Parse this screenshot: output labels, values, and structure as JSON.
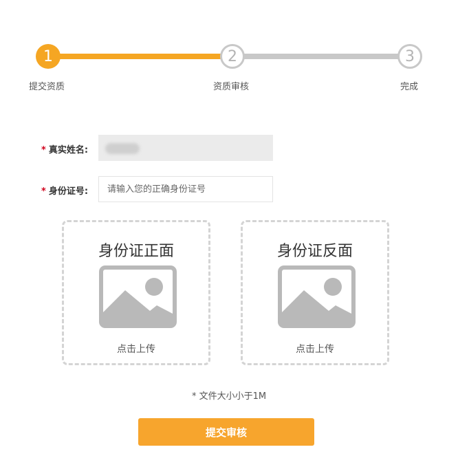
{
  "stepper": {
    "steps": [
      {
        "number": "1",
        "label": "提交资质",
        "state": "active"
      },
      {
        "number": "2",
        "label": "资质审核",
        "state": "inactive"
      },
      {
        "number": "3",
        "label": "完成",
        "state": "inactive"
      }
    ]
  },
  "form": {
    "name": {
      "required_mark": "*",
      "label": "真实姓名:",
      "value_blurred": true
    },
    "id_number": {
      "required_mark": "*",
      "label": "身份证号:",
      "value": "",
      "placeholder": "请输入您的正确身份证号"
    }
  },
  "uploads": {
    "front": {
      "title": "身份证正面",
      "hint": "点击上传",
      "icon": "image-placeholder-icon"
    },
    "back": {
      "title": "身份证反面",
      "hint": "点击上传",
      "icon": "image-placeholder-icon"
    }
  },
  "note": "* 文件大小小于1M",
  "submit_label": "提交审核",
  "colors": {
    "accent": "#f5a623",
    "inactive": "#c8c8c8",
    "required": "#d0021b",
    "icon_gray": "#b9b9b9"
  }
}
